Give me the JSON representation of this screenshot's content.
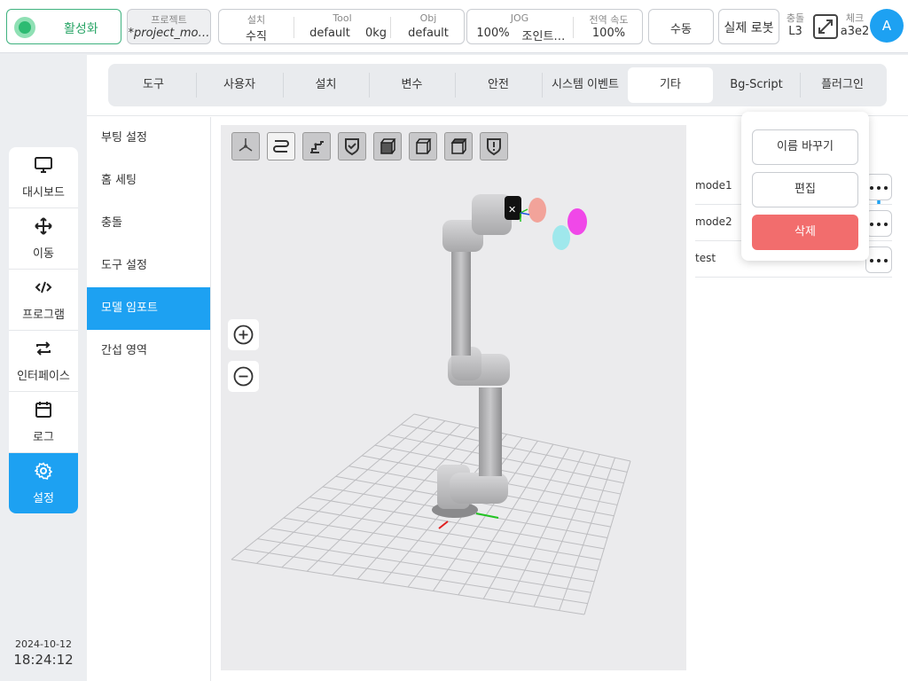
{
  "topbar": {
    "activate": {
      "label": "활성화"
    },
    "project": {
      "label": "프로젝트",
      "value": "*project_mo…"
    },
    "install": {
      "label": "설치",
      "value": "수직"
    },
    "tool": {
      "label": "Tool",
      "value": "default",
      "weight": "0kg"
    },
    "obj": {
      "label": "Obj",
      "value": "default"
    },
    "jog": {
      "label": "JOG",
      "value": "100%",
      "mode": "조인트…"
    },
    "global_speed": {
      "label": "전역 속도",
      "value": "100%"
    },
    "manual": {
      "label": "수동"
    },
    "real_robot": {
      "label": "실제 로봇"
    },
    "collision": {
      "label": "충돌",
      "value": "L3"
    },
    "check": {
      "label": "체크",
      "value": "a3e2"
    },
    "avatar": {
      "letter": "A"
    }
  },
  "nav": {
    "items": [
      {
        "label": "대시보드",
        "icon": "monitor-icon"
      },
      {
        "label": "이동",
        "icon": "move-arrows-icon"
      },
      {
        "label": "프로그램",
        "icon": "code-icon"
      },
      {
        "label": "인터페이스",
        "icon": "swap-arrows-icon"
      },
      {
        "label": "로그",
        "icon": "calendar-icon"
      },
      {
        "label": "설정",
        "icon": "gear-icon",
        "active": true
      }
    ]
  },
  "datetime": {
    "date": "2024-10-12",
    "time": "18:24:12"
  },
  "tabs": [
    {
      "label": "도구"
    },
    {
      "label": "사용자"
    },
    {
      "label": "설치"
    },
    {
      "label": "변수"
    },
    {
      "label": "안전"
    },
    {
      "label": "시스템 이벤트"
    },
    {
      "label": "기타",
      "active": true
    },
    {
      "label": "Bg-Script"
    },
    {
      "label": "플러그인"
    }
  ],
  "subnav": [
    {
      "label": "부팅 설정"
    },
    {
      "label": "홈 세팅"
    },
    {
      "label": "충돌"
    },
    {
      "label": "도구 설정"
    },
    {
      "label": "모델 임포트",
      "active": true
    },
    {
      "label": "간섭 영역"
    }
  ],
  "viewport": {
    "toolbar_icons": [
      "axis-view-icon",
      "path-icon",
      "robot-arm-icon",
      "shield-check-icon",
      "cube-front-icon",
      "cube-iso-icon",
      "cube-side-icon",
      "shield-alert-icon"
    ],
    "zoom_in_icon": "zoom-in-icon",
    "zoom_out_icon": "zoom-out-icon"
  },
  "models": [
    {
      "name": "mode1"
    },
    {
      "name": "mode2"
    },
    {
      "name": "test"
    }
  ],
  "popover": {
    "rename": "이름 바꾸기",
    "edit": "편집",
    "delete": "삭제"
  },
  "colors": {
    "accent": "#1da1f2",
    "active_green": "#2dbb72",
    "danger": "#f26d6d"
  }
}
